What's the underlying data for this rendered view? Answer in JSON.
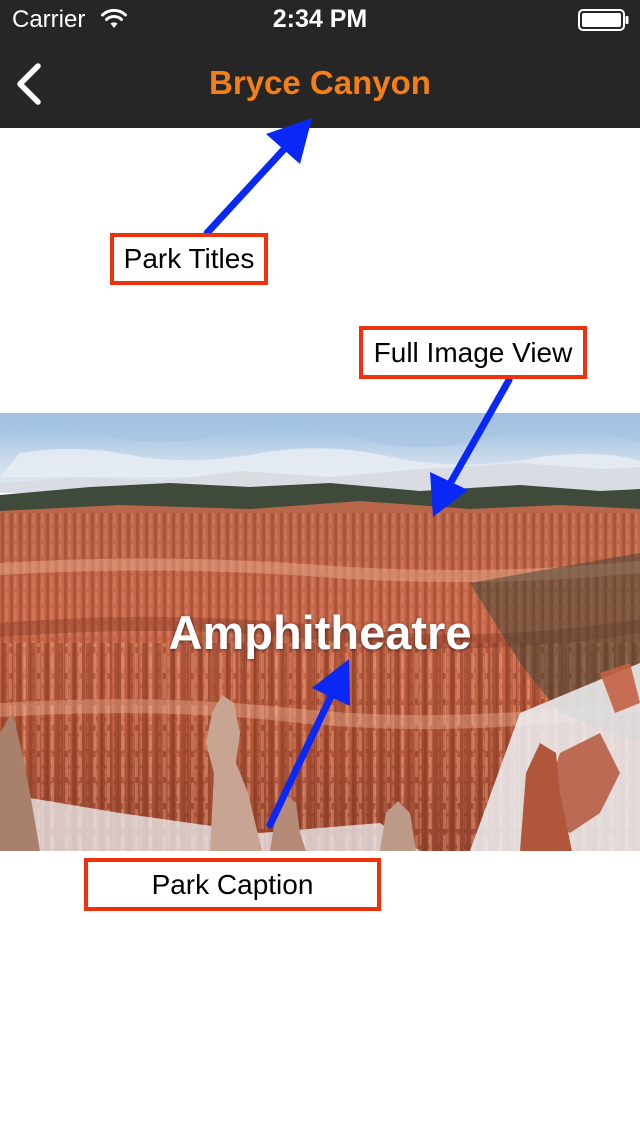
{
  "status_bar": {
    "carrier": "Carrier",
    "time": "2:34 PM",
    "wifi_icon": "wifi-icon",
    "battery_icon": "battery-icon"
  },
  "nav_bar": {
    "back_icon": "chevron-left-icon",
    "title": "Bryce Canyon",
    "title_color": "#f47f16",
    "background": "#262626"
  },
  "park": {
    "caption": "Amphitheatre"
  },
  "annotations": {
    "titles_label": "Park Titles",
    "full_image_label": "Full Image View",
    "caption_label": "Park Caption",
    "box_color": "#f0310d",
    "arrow_color": "#0a28f5"
  }
}
